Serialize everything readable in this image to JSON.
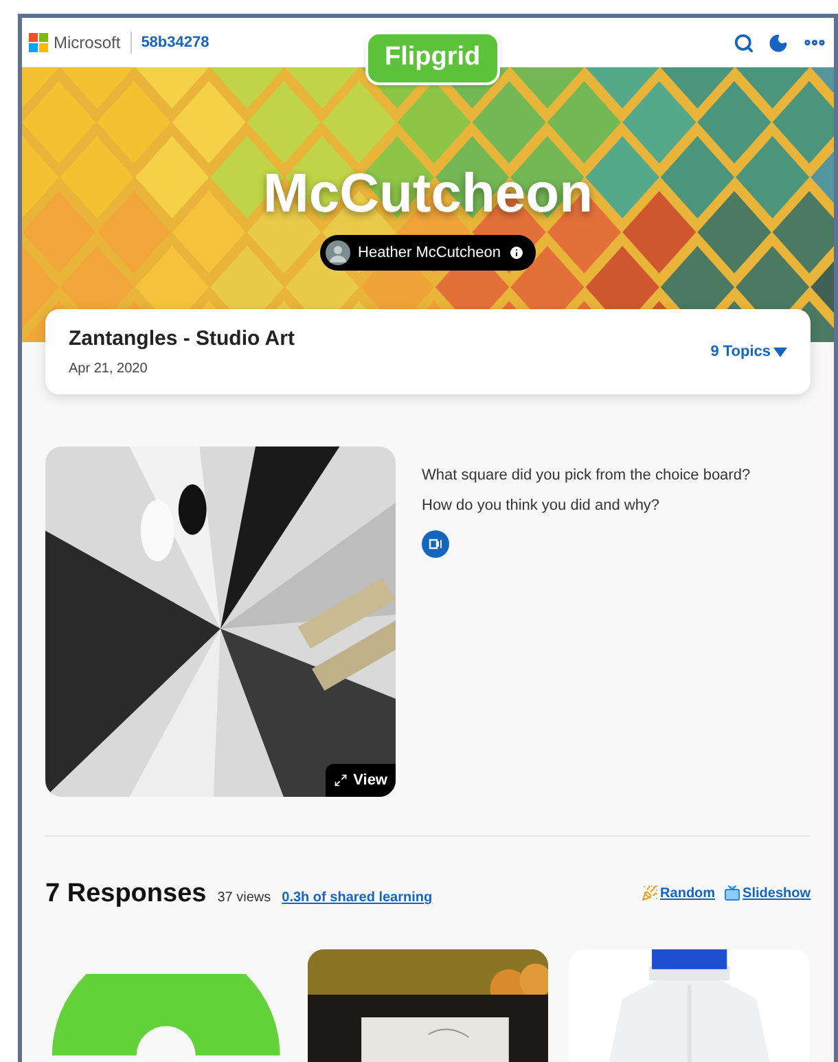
{
  "header": {
    "brand": "Microsoft",
    "code": "58b34278",
    "logo": "Flipgrid"
  },
  "banner": {
    "title": "McCutcheon",
    "owner": "Heather McCutcheon"
  },
  "topic": {
    "title": "Zantangles - Studio Art",
    "date": "Apr 21, 2020",
    "topics_link": "9 Topics"
  },
  "prompt": {
    "lines": [
      "What square did you pick from the choice board?",
      "How do you think you did and why?"
    ],
    "view_button": "View"
  },
  "responses": {
    "title": "7 Responses",
    "views": "37 views",
    "shared_link": "0.3h of shared learning",
    "actions": [
      "Random",
      "Slideshow"
    ]
  },
  "thumbnails": [
    {
      "kind": "ring"
    },
    {
      "kind": "picture"
    },
    {
      "kind": "picture"
    }
  ]
}
